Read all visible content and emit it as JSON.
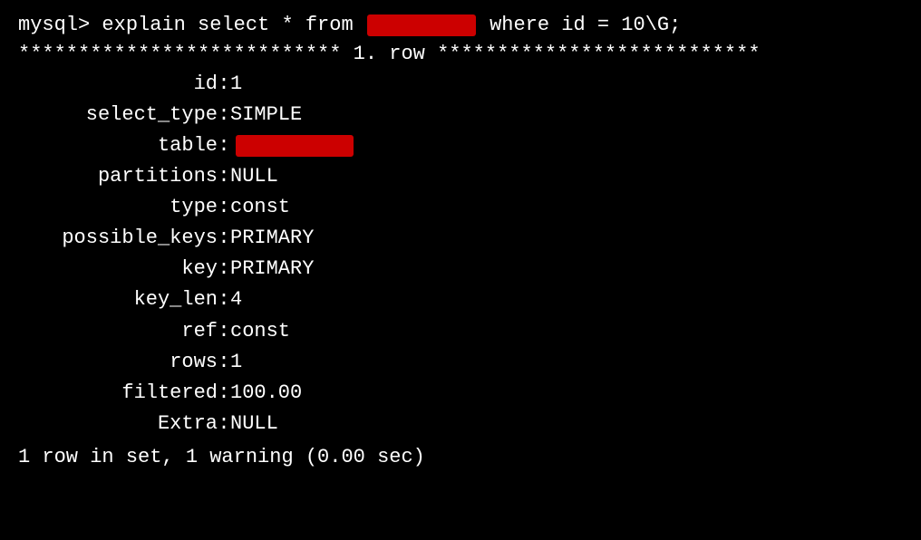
{
  "terminal": {
    "prompt": "mysql>",
    "command_prefix": " explain select * from ",
    "redacted_table_1": "████████",
    "command_suffix": " where id = 10\\G;",
    "divider": "*************************** 1. row ***************************",
    "fields": [
      {
        "name": "id",
        "value": "1"
      },
      {
        "name": "select_type",
        "value": "SIMPLE"
      },
      {
        "name": "table",
        "value": "REDACTED"
      },
      {
        "name": "partitions",
        "value": "NULL"
      },
      {
        "name": "type",
        "value": "const"
      },
      {
        "name": "possible_keys",
        "value": "PRIMARY"
      },
      {
        "name": "key",
        "value": "PRIMARY"
      },
      {
        "name": "key_len",
        "value": "4"
      },
      {
        "name": "ref",
        "value": "const"
      },
      {
        "name": "rows",
        "value": "1"
      },
      {
        "name": "filtered",
        "value": "100.00"
      },
      {
        "name": "Extra",
        "value": "NULL"
      }
    ],
    "footer": "1 row in set, 1 warning (0.00 sec)"
  }
}
